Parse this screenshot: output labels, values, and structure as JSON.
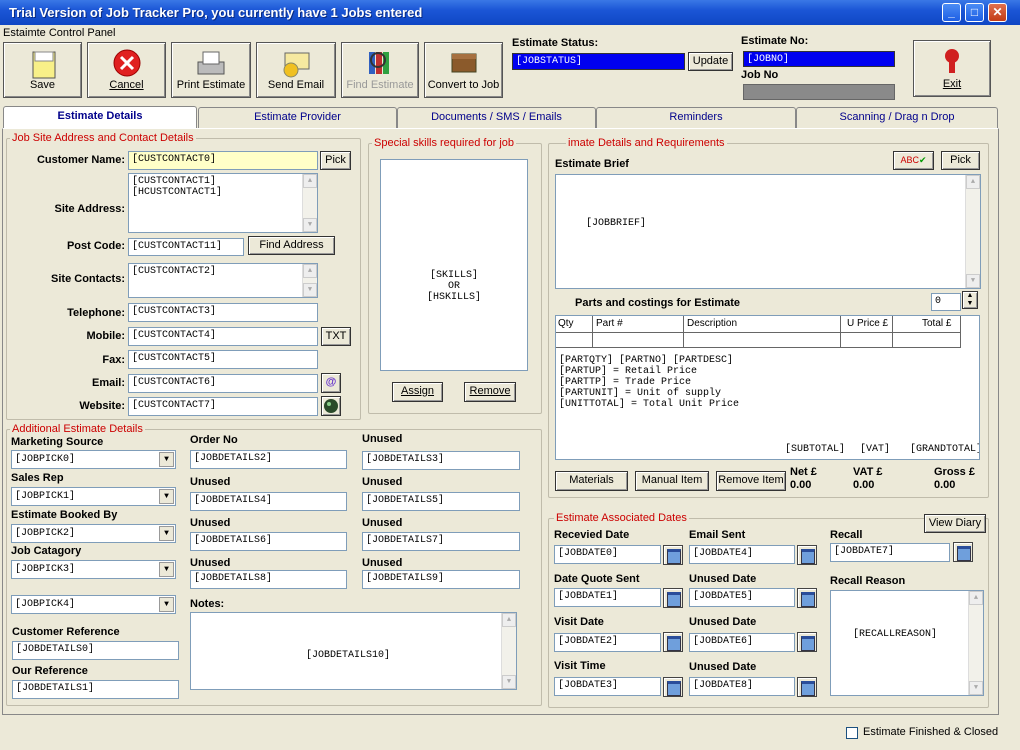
{
  "window": {
    "title": "Trial Version of Job Tracker Pro, you currently have 1 Jobs entered"
  },
  "control_panel": {
    "label": "Estaimte Control Panel",
    "save": "Save",
    "cancel": "Cancel",
    "print": "Print Estimate",
    "email": "Send Email",
    "find": "Find Estimate",
    "convert": "Convert to Job",
    "exit": "Exit"
  },
  "status": {
    "label": "Estimate Status:",
    "value": "[JOBSTATUS]",
    "update": "Update",
    "estno_label": "Estimate  No:",
    "estno_value": "[JOBNO]",
    "jobno_label": "Job No",
    "jobno_value": ""
  },
  "tabs": [
    "Estimate Details",
    "Estimate Provider",
    "Documents / SMS / Emails",
    "Reminders",
    "Scanning / Drag n Drop"
  ],
  "jobsite": {
    "title": "Job Site Address and Contact Details",
    "customer_name_label": "Customer Name:",
    "customer_name": "[CUSTCONTACT0]",
    "pick": "Pick",
    "site_address_label": "Site Address:",
    "site_address": "[CUSTCONTACT1]\n[HCUSTCONTACT1]",
    "postcode_label": "Post Code:",
    "postcode": "[CUSTCONTACT11]",
    "find_address": "Find Address",
    "site_contacts_label": "Site Contacts:",
    "site_contacts": "[CUSTCONTACT2]",
    "telephone_label": "Telephone:",
    "telephone": "[CUSTCONTACT3]",
    "mobile_label": "Mobile:",
    "mobile": "[CUSTCONTACT4]",
    "txt": "TXT",
    "fax_label": "Fax:",
    "fax": "[CUSTCONTACT5]",
    "email_label": "Email:",
    "email": "[CUSTCONTACT6]",
    "website_label": "Website:",
    "website": "[CUSTCONTACT7]"
  },
  "skills": {
    "title": "Special skills required for job",
    "value": "[SKILLS]\nOR\n[HSKILLS]",
    "assign": "Assign",
    "remove": "Remove"
  },
  "estimate_details": {
    "title": "imate Details and Requirements",
    "brief_label": "Estimate Brief",
    "brief": "[JOBBRIEF]",
    "pick": "Pick",
    "parts_label": "Parts and costings for Estimate",
    "parts_count": "0",
    "columns": [
      "Qty",
      "Part #",
      "Description",
      "U Price £",
      "Total £"
    ],
    "parts_text": "[PARTQTY] [PARTNO] [PARTDESC]\n[PARTUP] = Retail Price\n[PARTTP] = Trade Price\n[PARTUNIT] = Unit of supply\n[UNITTOTAL] = Total Unit Price",
    "subtotal": "[SUBTOTAL]",
    "vat": "[VAT]",
    "grandtotal": "[GRANDTOTAL]",
    "materials": "Materials",
    "manual_item": "Manual Item",
    "remove_item": "Remove Item",
    "net_label": "Net £",
    "net": "0.00",
    "vat_label": "VAT £",
    "vat_value": "0.00",
    "gross_label": "Gross £",
    "gross": "0.00"
  },
  "additional": {
    "title": "Additional Estimate Details",
    "marketing_label": "Marketing Source",
    "marketing": "[JOBPICK0]",
    "salesrep_label": "Sales Rep",
    "salesrep": "[JOBPICK1]",
    "bookedby_label": "Estimate Booked By",
    "bookedby": "[JOBPICK2]",
    "category_label": "Job Catagory",
    "category": "[JOBPICK3]",
    "pick4": "[JOBPICK4]",
    "custref_label": "Customer Reference",
    "custref": "[JOBDETAILS0]",
    "ourref_label": "Our Reference",
    "ourref": "[JOBDETAILS1]",
    "orderno_label": "Order No",
    "orderno": "[JOBDETAILS2]",
    "unused_label": "Unused",
    "d3": "[JOBDETAILS3]",
    "d4": "[JOBDETAILS4]",
    "d5": "[JOBDETAILS5]",
    "d6": "[JOBDETAILS6]",
    "d7": "[JOBDETAILS7]",
    "d8": "[JOBDETAILS8]",
    "d9": "[JOBDETAILS9]",
    "notes_label": "Notes:",
    "notes": "[JOBDETAILS10]"
  },
  "dates": {
    "title": "Estimate Associated Dates",
    "view_diary": "View Diary",
    "received_label": "Recevied Date",
    "received": "[JOBDATE0]",
    "emailsent_label": "Email Sent",
    "emailsent": "[JOBDATE4]",
    "recall_label": "Recall",
    "recall": "[JOBDATE7]",
    "quote_label": "Date Quote Sent",
    "quote": "[JOBDATE1]",
    "unused_label": "Unused Date",
    "u5": "[JOBDATE5]",
    "u6": "[JOBDATE6]",
    "u8": "[JOBDATE8]",
    "recall_reason_label": "Recall Reason",
    "recall_reason": "[RECALLREASON]",
    "visit_label": "Visit Date",
    "visit": "[JOBDATE2]",
    "visittime_label": "Visit Time",
    "visittime": "[JOBDATE3]"
  },
  "footer": {
    "finished": "Estimate Finished & Closed"
  }
}
